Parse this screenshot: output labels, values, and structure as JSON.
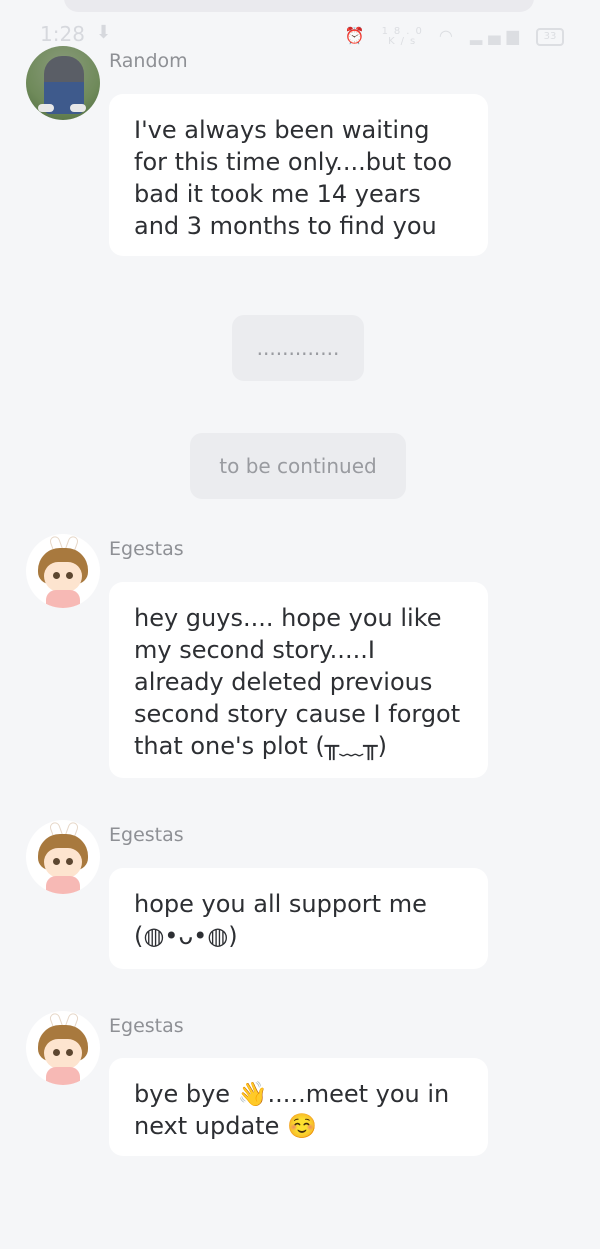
{
  "status_bar": {
    "time": "1:28",
    "net_speed": "18.0\nK/s",
    "battery": "33"
  },
  "messages": [
    {
      "sender": "Random",
      "text": "I've always been waiting for this time only....but too bad it took me 14 years and 3 months to find you"
    },
    {
      "sender": "Egestas",
      "text": "hey guys.... hope you like my second story.....I already deleted previous second story cause I forgot that one's plot (╥﹏╥)"
    },
    {
      "sender": "Egestas",
      "text": "hope you all support me (◍•ᴗ•◍)"
    },
    {
      "sender": "Egestas",
      "text": "bye bye 👋.....meet you in next update ☺️"
    }
  ],
  "narration": [
    {
      "text": "............."
    },
    {
      "text": "to be continued"
    }
  ],
  "icons": {
    "download": "download-icon",
    "alarm": "alarm-icon",
    "wifi": "wifi-icon",
    "signal": "signal-icon",
    "battery": "battery-icon"
  }
}
